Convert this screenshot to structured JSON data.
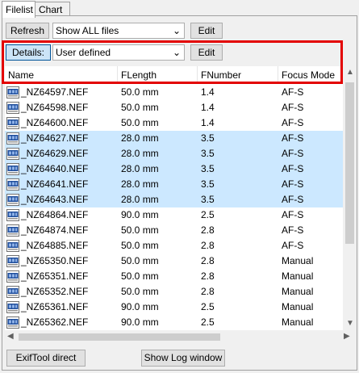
{
  "tabs": [
    {
      "label": "Filelist",
      "active": true
    },
    {
      "label": "Chart",
      "active": false
    }
  ],
  "toolbar1": {
    "refresh_label": "Refresh",
    "filter_value": "Show ALL files",
    "edit_label": "Edit"
  },
  "toolbar2": {
    "details_label": "Details:",
    "details_value": "User defined",
    "edit_label": "Edit"
  },
  "table": {
    "columns": [
      "Name",
      "FLength",
      "FNumber",
      "Focus Mode"
    ],
    "sorted_column": "Name",
    "rows": [
      {
        "name": "_NZ64597.NEF",
        "flength": "50.0 mm",
        "fnumber": "1.4",
        "focus": "AF-S",
        "selected": false
      },
      {
        "name": "_NZ64598.NEF",
        "flength": "50.0 mm",
        "fnumber": "1.4",
        "focus": "AF-S",
        "selected": false
      },
      {
        "name": "_NZ64600.NEF",
        "flength": "50.0 mm",
        "fnumber": "1.4",
        "focus": "AF-S",
        "selected": false
      },
      {
        "name": "_NZ64627.NEF",
        "flength": "28.0 mm",
        "fnumber": "3.5",
        "focus": "AF-S",
        "selected": true
      },
      {
        "name": "_NZ64629.NEF",
        "flength": "28.0 mm",
        "fnumber": "3.5",
        "focus": "AF-S",
        "selected": true
      },
      {
        "name": "_NZ64640.NEF",
        "flength": "28.0 mm",
        "fnumber": "3.5",
        "focus": "AF-S",
        "selected": true
      },
      {
        "name": "_NZ64641.NEF",
        "flength": "28.0 mm",
        "fnumber": "3.5",
        "focus": "AF-S",
        "selected": true
      },
      {
        "name": "_NZ64643.NEF",
        "flength": "28.0 mm",
        "fnumber": "3.5",
        "focus": "AF-S",
        "selected": true
      },
      {
        "name": "_NZ64864.NEF",
        "flength": "90.0 mm",
        "fnumber": "2.5",
        "focus": "AF-S",
        "selected": false
      },
      {
        "name": "_NZ64874.NEF",
        "flength": "50.0 mm",
        "fnumber": "2.8",
        "focus": "AF-S",
        "selected": false
      },
      {
        "name": "_NZ64885.NEF",
        "flength": "50.0 mm",
        "fnumber": "2.8",
        "focus": "AF-S",
        "selected": false
      },
      {
        "name": "_NZ65350.NEF",
        "flength": "50.0 mm",
        "fnumber": "2.8",
        "focus": "Manual",
        "selected": false
      },
      {
        "name": "_NZ65351.NEF",
        "flength": "50.0 mm",
        "fnumber": "2.8",
        "focus": "Manual",
        "selected": false
      },
      {
        "name": "_NZ65352.NEF",
        "flength": "50.0 mm",
        "fnumber": "2.8",
        "focus": "Manual",
        "selected": false
      },
      {
        "name": "_NZ65361.NEF",
        "flength": "90.0 mm",
        "fnumber": "2.5",
        "focus": "Manual",
        "selected": false
      },
      {
        "name": "_NZ65362.NEF",
        "flength": "90.0 mm",
        "fnumber": "2.5",
        "focus": "Manual",
        "selected": false
      }
    ]
  },
  "bottom": {
    "exiftool_label": "ExifTool direct",
    "log_label": "Show Log window"
  },
  "colors": {
    "selection": "#cce8ff",
    "highlight_box": "#e30000",
    "icon_blue": "#1f4e9c"
  },
  "icons": {
    "file_icon": "nef-file-icon",
    "dropdown": "chevron-down-icon",
    "sort": "sort-ascending-icon"
  }
}
